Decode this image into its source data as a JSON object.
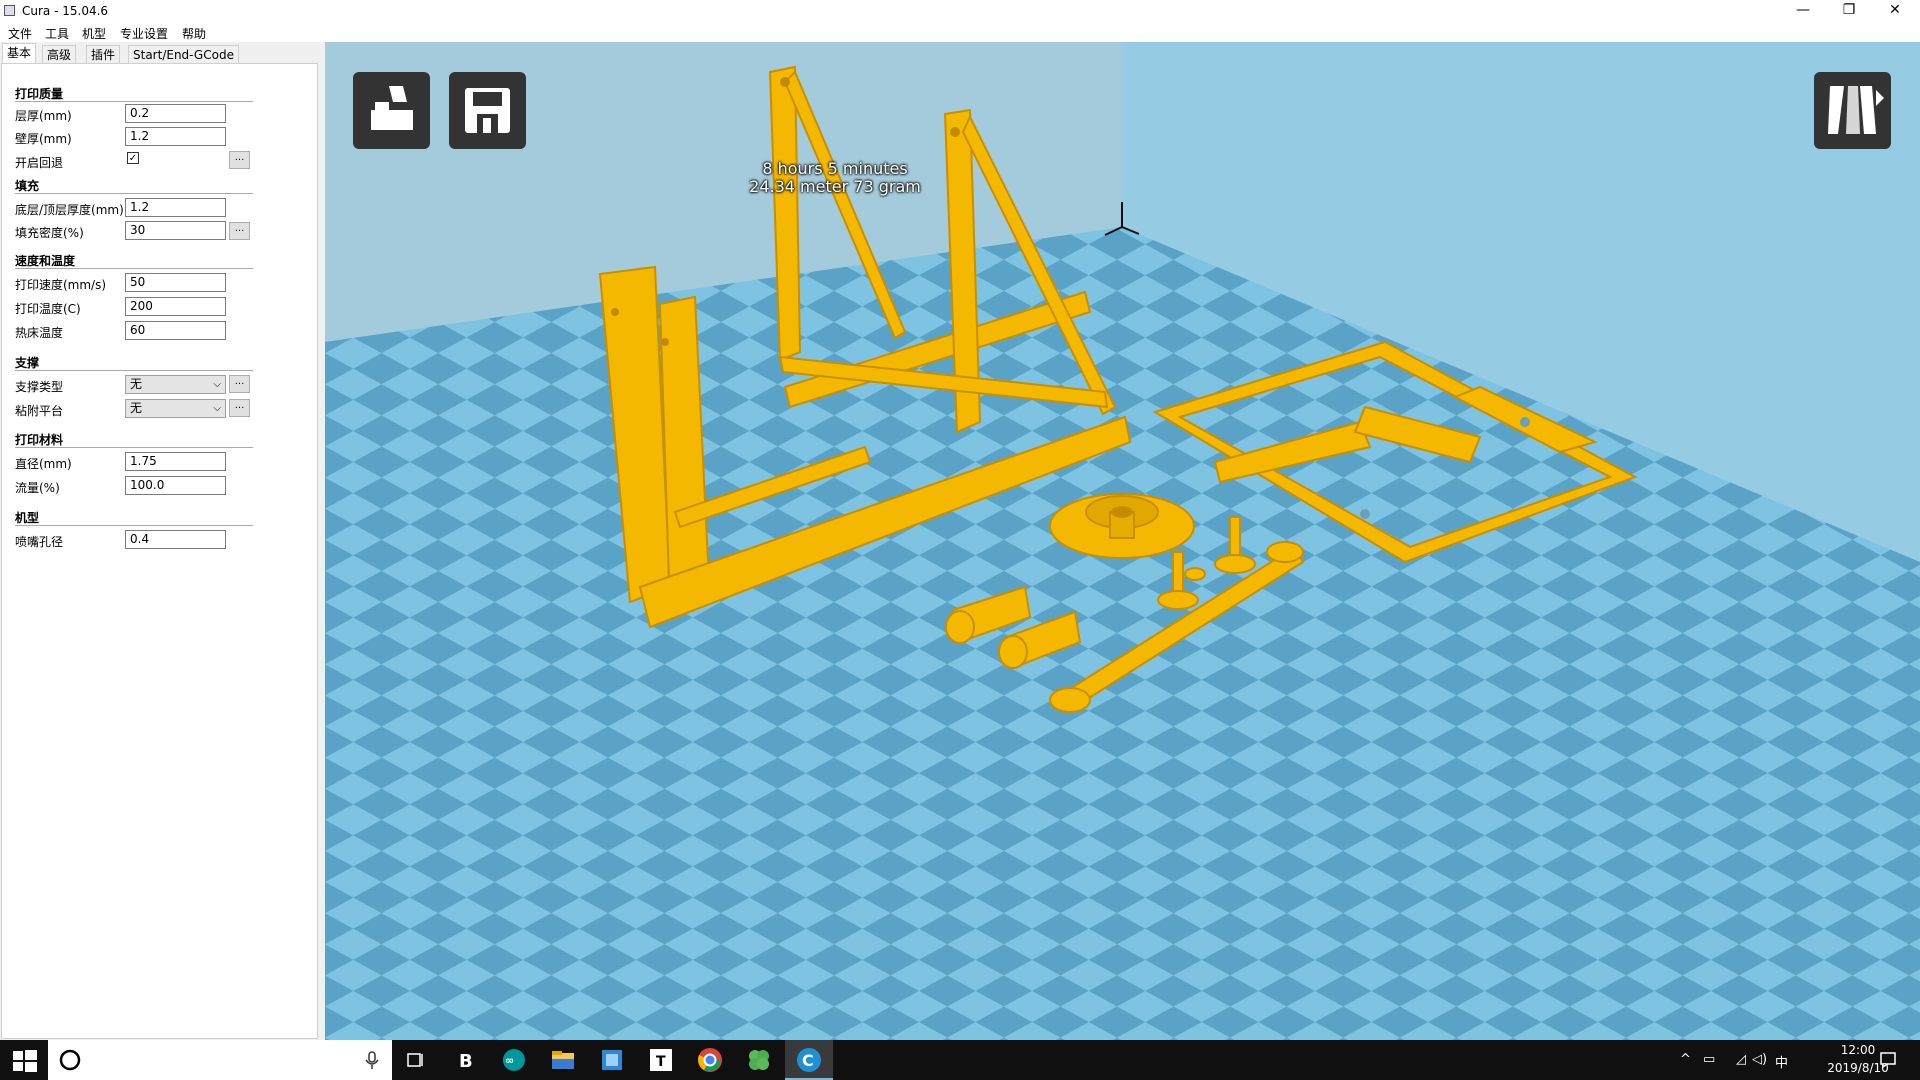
{
  "window": {
    "title": "Cura - 15.04.6",
    "minimize": "—",
    "restore": "❐",
    "close": "✕"
  },
  "menu": [
    "文件",
    "工具",
    "机型",
    "专业设置",
    "帮助"
  ],
  "tabs": [
    "基本",
    "高级",
    "插件",
    "Start/End-GCode"
  ],
  "sections": {
    "quality": {
      "title": "打印质量",
      "layer_height_label": "层厚(mm)",
      "layer_height": "0.2",
      "shell_label": "壁厚(mm)",
      "shell": "1.2",
      "retraction_label": "开启回退",
      "retraction_checked": "✓",
      "dots": "..."
    },
    "fill": {
      "title": "填充",
      "bottom_top_label": "底层/顶层厚度(mm)",
      "bottom_top": "1.2",
      "density_label": "填充密度(%)",
      "density": "30",
      "dots": "..."
    },
    "speed": {
      "title": "速度和温度",
      "print_speed_label": "打印速度(mm/s)",
      "print_speed": "50",
      "temp_label": "打印温度(C)",
      "temp": "200",
      "bed_temp_label": "热床温度",
      "bed_temp": "60"
    },
    "support": {
      "title": "支撑",
      "type_label": "支撑类型",
      "type": "无",
      "adhesion_label": "粘附平台",
      "adhesion": "无",
      "dots": "..."
    },
    "filament": {
      "title": "打印材料",
      "diameter_label": "直径(mm)",
      "diameter": "1.75",
      "flow_label": "流量(%)",
      "flow": "100.0"
    },
    "machine": {
      "title": "机型",
      "nozzle_label": "喷嘴孔径",
      "nozzle": "0.4"
    }
  },
  "viewport": {
    "print_time": "8 hours 5 minutes",
    "print_material": "24.34 meter 73 gram",
    "model_color": "#f5b800",
    "bed_color_light": "#7fc4e2",
    "bed_color_dark": "#5ba4c8"
  },
  "taskbar": {
    "time": "12:00",
    "date": "2019/8/10",
    "ime": "中"
  }
}
